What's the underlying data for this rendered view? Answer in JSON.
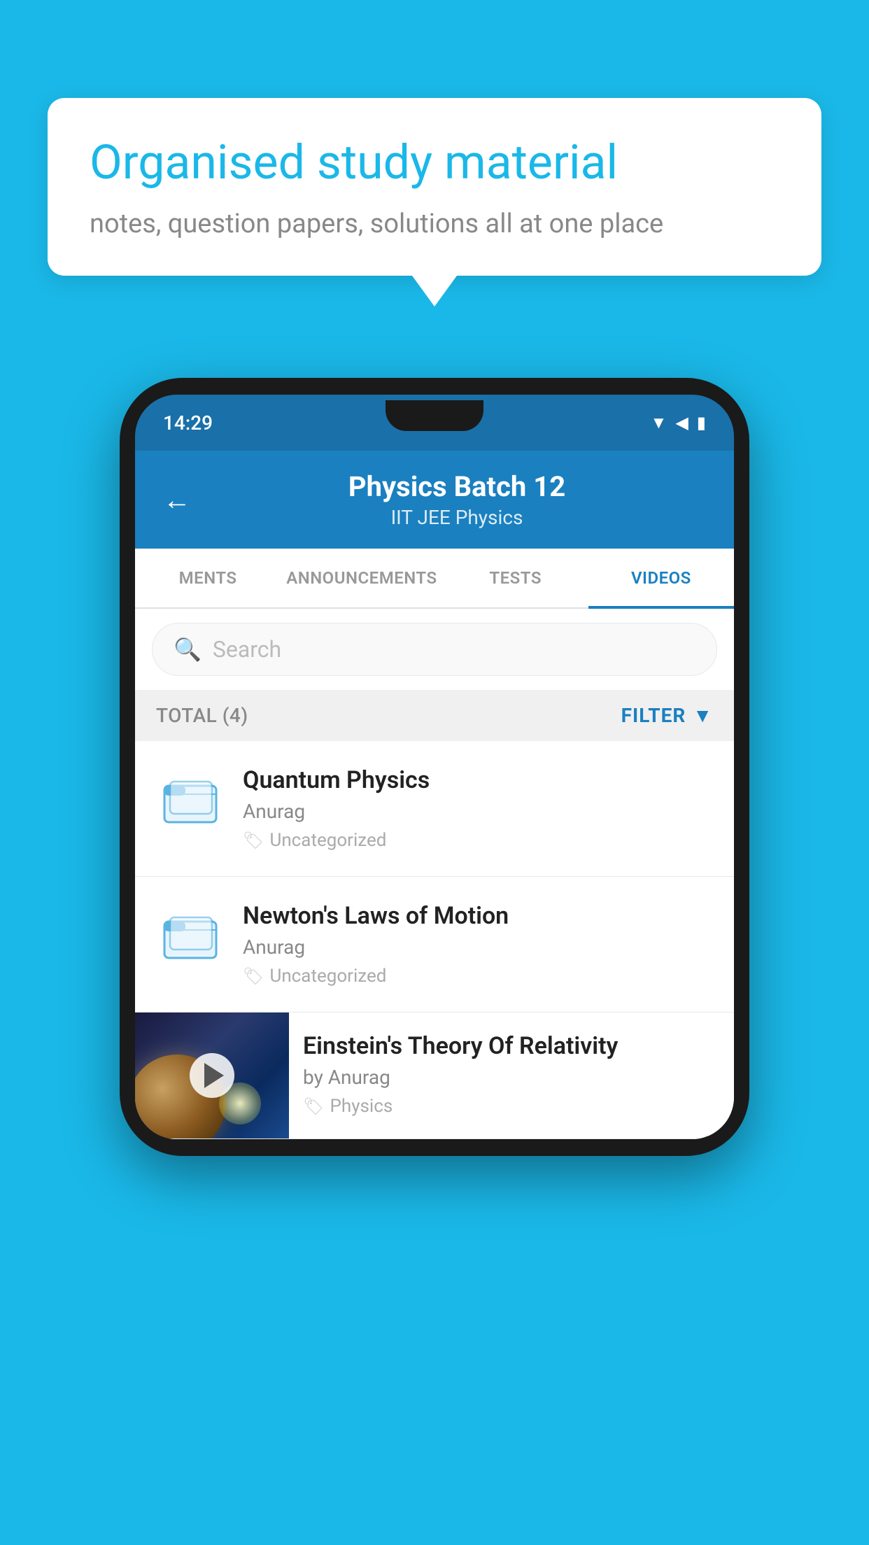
{
  "background_color": "#1ab8e8",
  "speech_bubble": {
    "title": "Organised study material",
    "subtitle": "notes, question papers, solutions all at one place"
  },
  "status_bar": {
    "time": "14:29",
    "wifi_icon": "wifi",
    "signal_icon": "signal",
    "battery_icon": "battery"
  },
  "app_header": {
    "back_label": "←",
    "title": "Physics Batch 12",
    "subtitle": "IIT JEE   Physics"
  },
  "tabs": [
    {
      "label": "MENTS",
      "active": false
    },
    {
      "label": "ANNOUNCEMENTS",
      "active": false
    },
    {
      "label": "TESTS",
      "active": false
    },
    {
      "label": "VIDEOS",
      "active": true
    }
  ],
  "search": {
    "placeholder": "Search"
  },
  "filter_bar": {
    "total_label": "TOTAL (4)",
    "filter_label": "FILTER"
  },
  "video_items": [
    {
      "id": 1,
      "title": "Quantum Physics",
      "author": "Anurag",
      "tag": "Uncategorized",
      "type": "folder",
      "has_thumbnail": false
    },
    {
      "id": 2,
      "title": "Newton's Laws of Motion",
      "author": "Anurag",
      "tag": "Uncategorized",
      "type": "folder",
      "has_thumbnail": false
    },
    {
      "id": 3,
      "title": "Einstein's Theory Of Relativity",
      "author": "by Anurag",
      "tag": "Physics",
      "type": "video",
      "has_thumbnail": true
    }
  ]
}
